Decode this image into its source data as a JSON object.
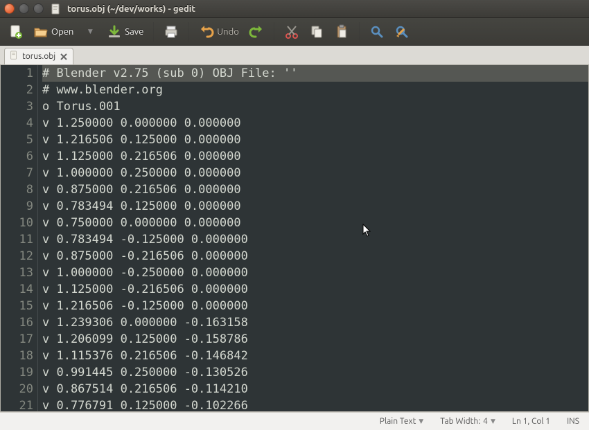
{
  "window": {
    "title": "torus.obj (~/dev/works) - gedit"
  },
  "toolbar": {
    "open_label": "Open",
    "save_label": "Save",
    "undo_label": "Undo"
  },
  "tabs": [
    {
      "label": "torus.obj"
    }
  ],
  "editor": {
    "lines": [
      "# Blender v2.75 (sub 0) OBJ File: ''",
      "# www.blender.org",
      "o Torus.001",
      "v 1.250000 0.000000 0.000000",
      "v 1.216506 0.125000 0.000000",
      "v 1.125000 0.216506 0.000000",
      "v 1.000000 0.250000 0.000000",
      "v 0.875000 0.216506 0.000000",
      "v 0.783494 0.125000 0.000000",
      "v 0.750000 0.000000 0.000000",
      "v 0.783494 -0.125000 0.000000",
      "v 0.875000 -0.216506 0.000000",
      "v 1.000000 -0.250000 0.000000",
      "v 1.125000 -0.216506 0.000000",
      "v 1.216506 -0.125000 0.000000",
      "v 1.239306 0.000000 -0.163158",
      "v 1.206099 0.125000 -0.158786",
      "v 1.115376 0.216506 -0.146842",
      "v 0.991445 0.250000 -0.130526",
      "v 0.867514 0.216506 -0.114210",
      "v 0.776791 0.125000 -0.102266"
    ],
    "line_numbers": [
      "1",
      "2",
      "3",
      "4",
      "5",
      "6",
      "7",
      "8",
      "9",
      "10",
      "11",
      "12",
      "13",
      "14",
      "15",
      "16",
      "17",
      "18",
      "19",
      "20",
      "21"
    ]
  },
  "statusbar": {
    "syntax": "Plain Text",
    "tabwidth_label": "Tab Width:",
    "tabwidth_value": "4",
    "position": "Ln 1, Col 1",
    "mode": "INS"
  }
}
